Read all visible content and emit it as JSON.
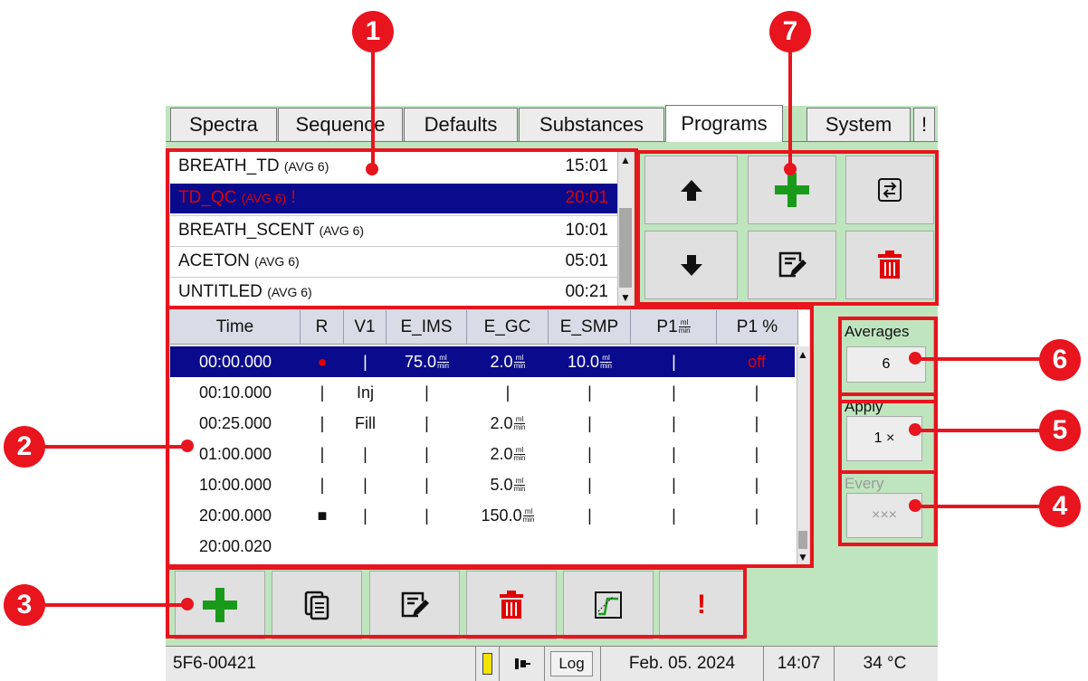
{
  "tabs": [
    {
      "label": "Spectra"
    },
    {
      "label": "Sequence"
    },
    {
      "label": "Defaults"
    },
    {
      "label": "Substances"
    },
    {
      "label": "Programs",
      "active": true
    },
    {
      "label": "System"
    },
    {
      "label": "!"
    }
  ],
  "programs": [
    {
      "name": "BREATH_TD",
      "avg": "(AVG 6)",
      "time": "15:01",
      "flag": ""
    },
    {
      "name": "TD_QC",
      "avg": "(AVG 6)",
      "time": "20:01",
      "flag": "!",
      "selected": true
    },
    {
      "name": "BREATH_SCENT",
      "avg": "(AVG 6)",
      "time": "10:01",
      "flag": ""
    },
    {
      "name": "ACETON",
      "avg": "(AVG 6)",
      "time": "05:01",
      "flag": ""
    },
    {
      "name": "UNTITLED",
      "avg": "(AVG 6)",
      "time": "00:21",
      "flag": ""
    }
  ],
  "program_buttons": [
    {
      "icon": "arrow-up-icon"
    },
    {
      "icon": "plus-icon"
    },
    {
      "icon": "swap-icon"
    },
    {
      "icon": "arrow-down-icon"
    },
    {
      "icon": "edit-icon"
    },
    {
      "icon": "trash-icon"
    }
  ],
  "table": {
    "headers": [
      "Time",
      "R",
      "V1",
      "E_IMS",
      "E_GC",
      "E_SMP",
      "P1",
      "P1 %"
    ],
    "unit": {
      "num": "ml",
      "den": "min"
    },
    "rows": [
      {
        "selected": true,
        "cells": [
          {
            "t": "00:00.000"
          },
          {
            "t": "●",
            "color": "#e00000"
          },
          {
            "t": "|"
          },
          {
            "t": "75.0",
            "u": true
          },
          {
            "t": "2.0",
            "u": true
          },
          {
            "t": "10.0",
            "u": true
          },
          {
            "t": "|"
          },
          {
            "t": "off",
            "color": "#e00000"
          }
        ]
      },
      {
        "cells": [
          {
            "t": "00:10.000"
          },
          {
            "t": "|"
          },
          {
            "t": "Inj"
          },
          {
            "t": "|"
          },
          {
            "t": "|"
          },
          {
            "t": "|"
          },
          {
            "t": "|"
          },
          {
            "t": "|"
          }
        ]
      },
      {
        "cells": [
          {
            "t": "00:25.000"
          },
          {
            "t": "|"
          },
          {
            "t": "Fill"
          },
          {
            "t": "|"
          },
          {
            "t": "2.0",
            "u": true
          },
          {
            "t": "|"
          },
          {
            "t": "|"
          },
          {
            "t": "|"
          }
        ]
      },
      {
        "cells": [
          {
            "t": "01:00.000"
          },
          {
            "t": "|"
          },
          {
            "t": "|"
          },
          {
            "t": "|"
          },
          {
            "t": "2.0",
            "u": true
          },
          {
            "t": "|"
          },
          {
            "t": "|"
          },
          {
            "t": "|"
          }
        ]
      },
      {
        "cells": [
          {
            "t": "10:00.000"
          },
          {
            "t": "|"
          },
          {
            "t": "|"
          },
          {
            "t": "|"
          },
          {
            "t": "5.0",
            "u": true
          },
          {
            "t": "|"
          },
          {
            "t": "|"
          },
          {
            "t": "|"
          }
        ]
      },
      {
        "cells": [
          {
            "t": "20:00.000"
          },
          {
            "t": "■"
          },
          {
            "t": "|"
          },
          {
            "t": "|"
          },
          {
            "t": "150.0",
            "u": true
          },
          {
            "t": "|"
          },
          {
            "t": "|"
          },
          {
            "t": "|"
          }
        ]
      },
      {
        "cells": [
          {
            "t": "20:00.020"
          },
          {
            "t": ""
          },
          {
            "t": ""
          },
          {
            "t": ""
          },
          {
            "t": ""
          },
          {
            "t": ""
          },
          {
            "t": ""
          },
          {
            "t": ""
          }
        ]
      }
    ]
  },
  "step_buttons": [
    {
      "icon": "plus-icon"
    },
    {
      "icon": "copy-icon"
    },
    {
      "icon": "edit-icon"
    },
    {
      "icon": "trash-icon"
    },
    {
      "icon": "chart-icon"
    },
    {
      "icon": "exclamation-icon",
      "label": "!"
    }
  ],
  "averages": {
    "label": "Averages",
    "value": "6"
  },
  "apply": {
    "label": "Apply",
    "value": "1 ×"
  },
  "every": {
    "label": "Every",
    "value": "×××"
  },
  "callouts": [
    "1",
    "2",
    "3",
    "4",
    "5",
    "6",
    "7"
  ],
  "status": {
    "device_id": "5F6-00421",
    "log": "Log",
    "date": "Feb. 05. 2024",
    "time": "14:07",
    "temperature": "34 °C"
  },
  "colors": {
    "accent_red": "#e8141e",
    "selection_blue": "#0a0a8c",
    "screen_green": "#bfe5bf",
    "plus_green": "#1a9a1a"
  }
}
